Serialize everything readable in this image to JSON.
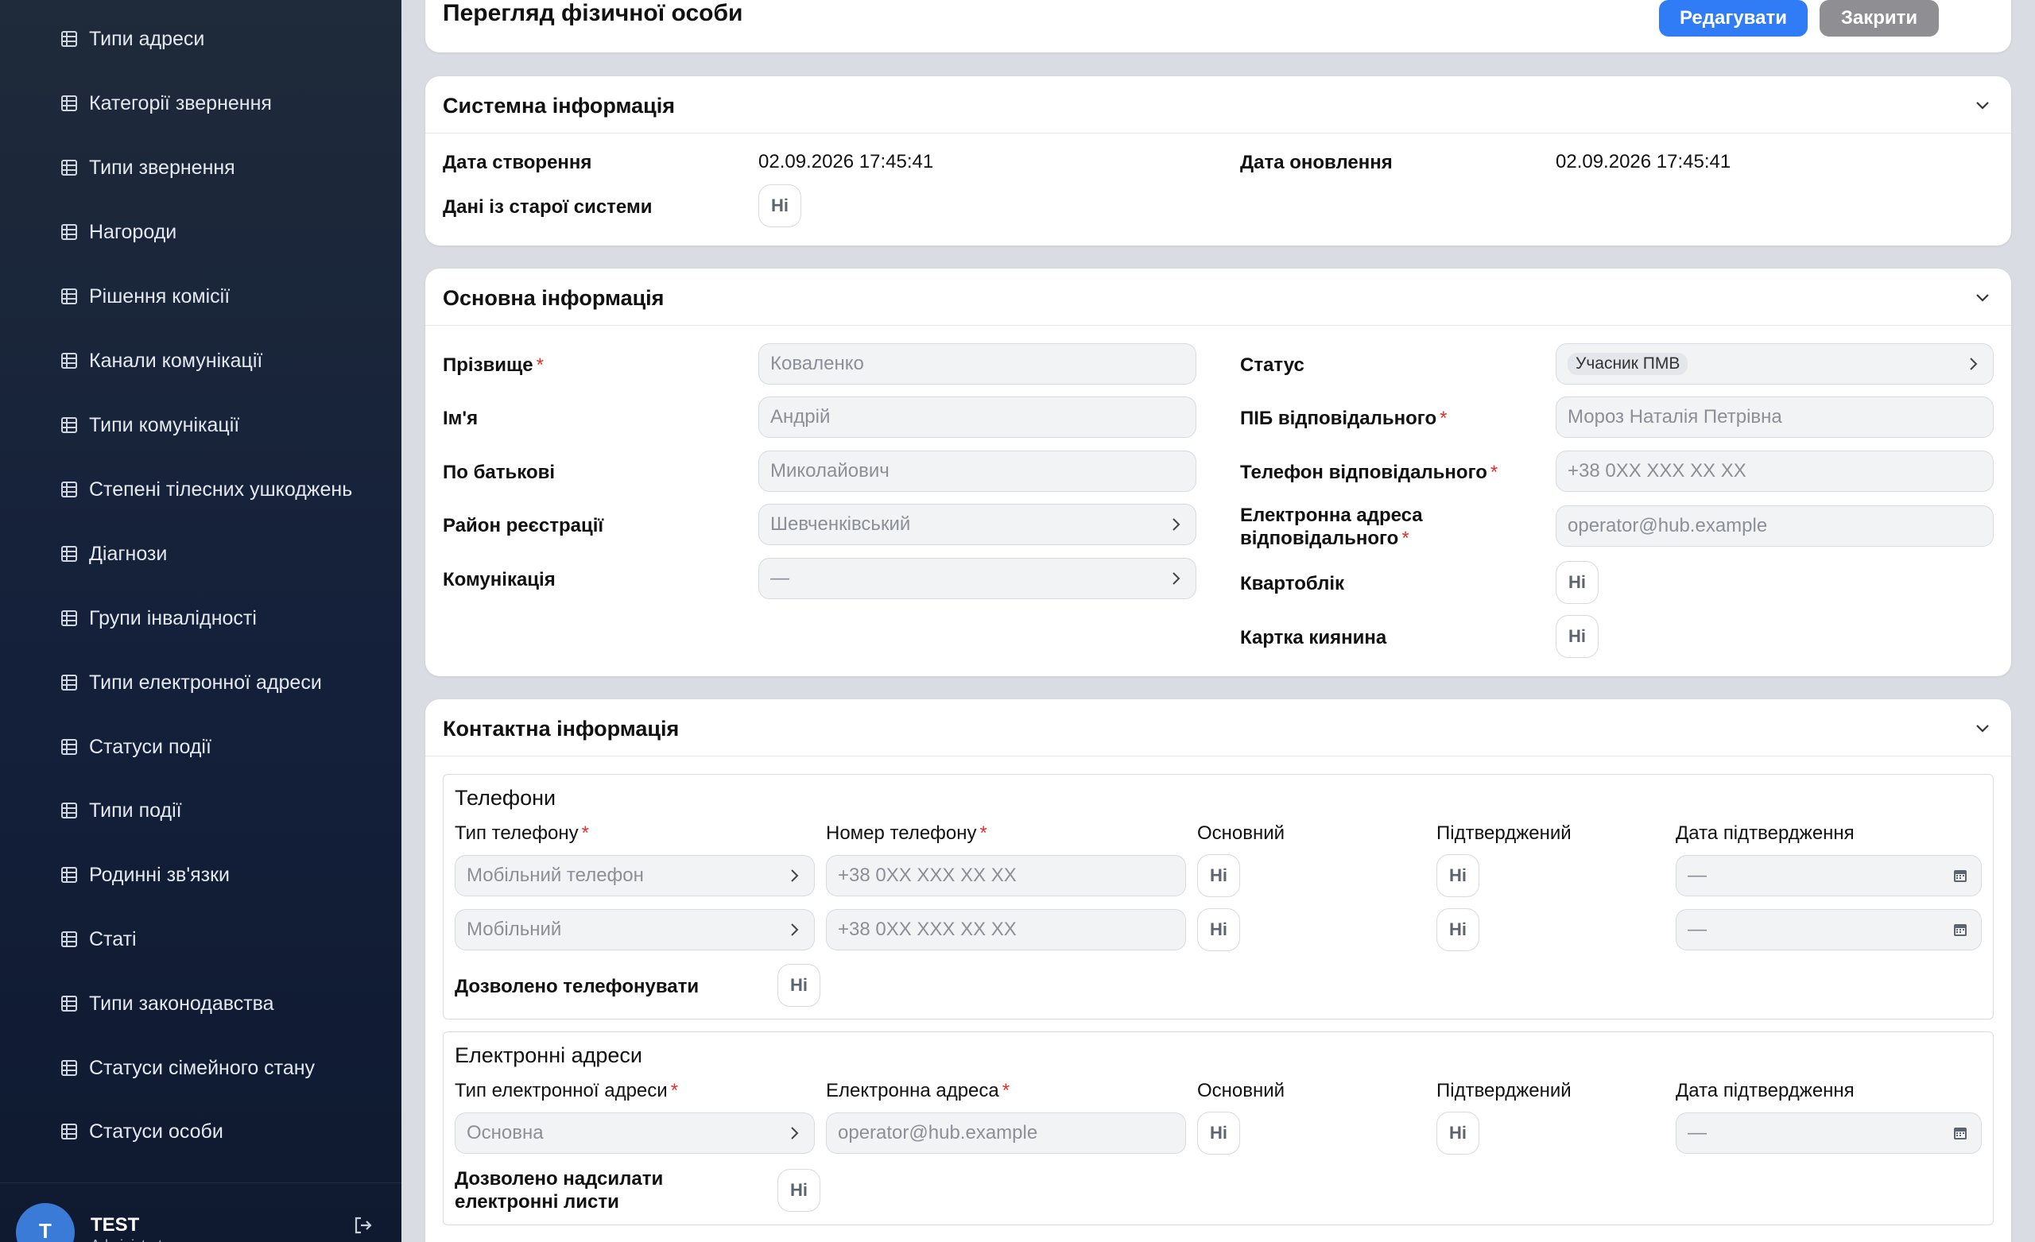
{
  "sidebar": {
    "items": [
      {
        "label": "Типи адреси"
      },
      {
        "label": "Категорії звернення"
      },
      {
        "label": "Типи звернення"
      },
      {
        "label": "Нагороди"
      },
      {
        "label": "Рішення комісії"
      },
      {
        "label": "Канали комунікації"
      },
      {
        "label": "Типи комунікації"
      },
      {
        "label": "Степені тілесних ушкоджень"
      },
      {
        "label": "Діагнози"
      },
      {
        "label": "Групи інвалідності"
      },
      {
        "label": "Типи електронної адреси"
      },
      {
        "label": "Статуси події"
      },
      {
        "label": "Типи події"
      },
      {
        "label": "Родинні зв'язки"
      },
      {
        "label": "Статі"
      },
      {
        "label": "Типи законодавства"
      },
      {
        "label": "Статуси сімейного стану"
      },
      {
        "label": "Статуси особи"
      }
    ],
    "user": {
      "initial": "T",
      "name": "TEST",
      "role": "Administrator"
    }
  },
  "header": {
    "title": "Перегляд фізичної особи",
    "edit_label": "Редагувати",
    "close_label": "Закрити"
  },
  "system": {
    "title": "Системна інформація",
    "created_label": "Дата створення",
    "created_value": "02.09.2026 17:45:41",
    "updated_label": "Дата оновлення",
    "updated_value": "02.09.2026 17:45:41",
    "legacy_label": "Дані із старої системи",
    "legacy_value": "Ні"
  },
  "basic": {
    "title": "Основна інформація",
    "surname_label": "Прізвище",
    "surname_value": "Коваленко",
    "name_label": "Ім'я",
    "name_value": "Андрій",
    "patronymic_label": "По батькові",
    "patronymic_value": "Миколайович",
    "district_label": "Район реєстрації",
    "district_value": "Шевченківський",
    "communication_label": "Комунікація",
    "communication_value": "—",
    "status_label": "Статус",
    "status_value": "Учасник ПМВ",
    "responsible_label": "ПІБ відповідального",
    "responsible_value": "Мороз Наталія Петрівна",
    "responsible_phone_label": "Телефон відповідального",
    "responsible_phone_value": "+38 0XX XXX XX XX",
    "responsible_email_label_1": "Електронна адреса",
    "responsible_email_label_2": "відповідального",
    "responsible_email_value": "operator@hub.example",
    "housing_label": "Квартоблік",
    "housing_value": "Ні",
    "kyiv_card_label": "Картка киянина",
    "kyiv_card_value": "Ні"
  },
  "contacts": {
    "title": "Контактна інформація",
    "phones": {
      "title": "Телефони",
      "col_type": "Тип телефону",
      "col_number": "Номер телефону",
      "col_main": "Основний",
      "col_confirmed": "Підтверджений",
      "col_confirm_date": "Дата підтвердження",
      "rows": [
        {
          "type": "Мобільний телефон",
          "number": "+38 0XX XXX XX XX",
          "main": "Ні",
          "confirmed": "Ні",
          "date": "—"
        },
        {
          "type": "Мобільний",
          "number": "+38 0XX XXX XX XX",
          "main": "Ні",
          "confirmed": "Ні",
          "date": "—"
        }
      ],
      "allow_call_label": "Дозволено телефонувати",
      "allow_call_value": "Ні"
    },
    "emails": {
      "title": "Електронні адреси",
      "col_type": "Тип електронної адреси",
      "col_address": "Електронна адреса",
      "col_main": "Основний",
      "col_confirmed": "Підтверджений",
      "col_confirm_date": "Дата підтвердження",
      "rows": [
        {
          "type": "Основна",
          "address": "operator@hub.example",
          "main": "Ні",
          "confirmed": "Ні",
          "date": "—"
        }
      ],
      "allow_send_label_1": "Дозволено надсилати",
      "allow_send_label_2": "електронні листи",
      "allow_send_value": "Ні"
    }
  }
}
